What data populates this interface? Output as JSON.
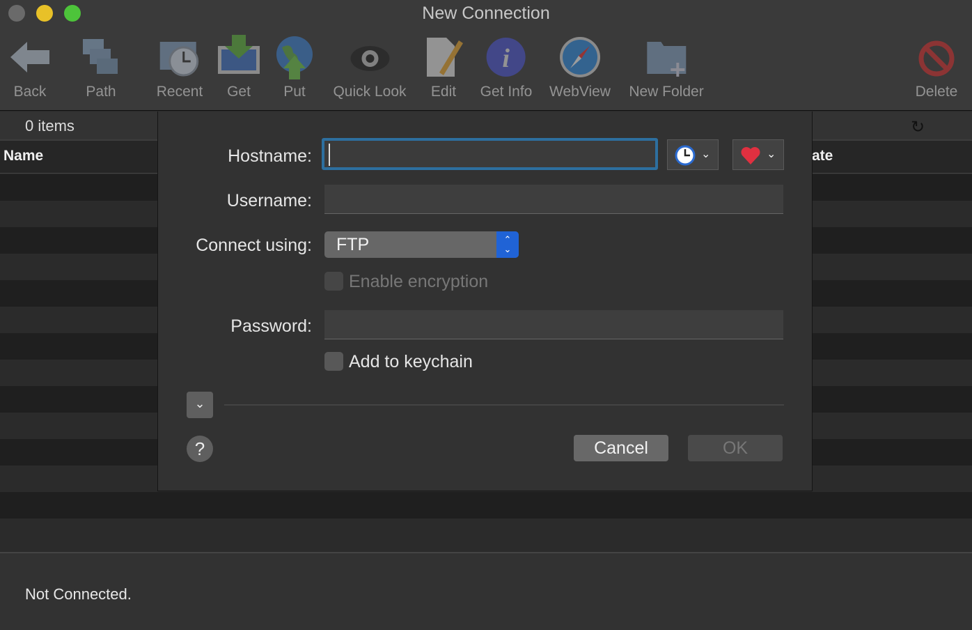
{
  "window": {
    "title": "New Connection",
    "traffic_lights": {
      "close": "#6a6a6a",
      "minimize": "#e8c128",
      "zoom": "#4dc43a"
    }
  },
  "toolbar": {
    "items": [
      {
        "label": "Back",
        "icon": "back-arrow-icon"
      },
      {
        "label": "Path",
        "icon": "path-folders-icon"
      },
      {
        "label": "Recent",
        "icon": "recent-clock-folder-icon"
      },
      {
        "label": "Get",
        "icon": "download-icon"
      },
      {
        "label": "Put",
        "icon": "upload-globe-icon"
      },
      {
        "label": "Quick Look",
        "icon": "eye-icon"
      },
      {
        "label": "Edit",
        "icon": "edit-pencil-icon"
      },
      {
        "label": "Get Info",
        "icon": "info-icon"
      },
      {
        "label": "WebView",
        "icon": "compass-icon"
      },
      {
        "label": "New Folder",
        "icon": "new-folder-icon"
      },
      {
        "label": "Delete",
        "icon": "delete-icon"
      }
    ]
  },
  "browser": {
    "item_count": "0 items",
    "columns": [
      "Name",
      "ate"
    ],
    "refresh_icon": "refresh-icon"
  },
  "status": {
    "text": "Not Connected."
  },
  "dialog": {
    "hostname_label": "Hostname:",
    "hostname_value": "",
    "username_label": "Username:",
    "username_value": "",
    "connect_label": "Connect using:",
    "protocol": "FTP",
    "encryption_label": "Enable encryption",
    "encryption_checked": false,
    "password_label": "Password:",
    "password_value": "",
    "keychain_label": "Add to keychain",
    "keychain_checked": false,
    "cancel": "Cancel",
    "ok": "OK",
    "help": "?",
    "accent": "#2063d6"
  }
}
